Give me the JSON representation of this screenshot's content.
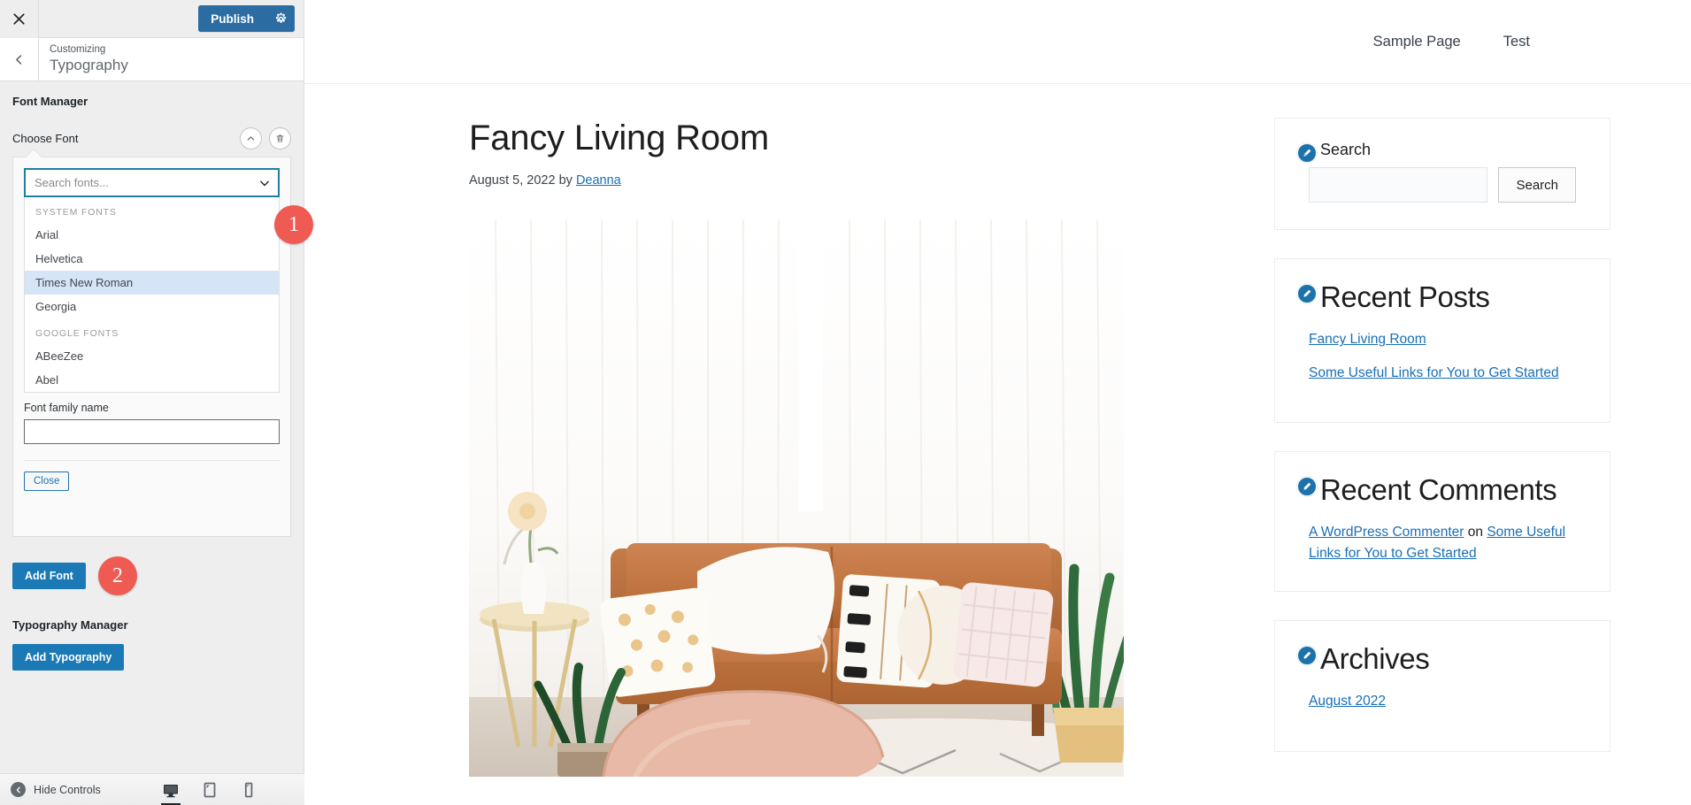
{
  "customizer": {
    "topbar": {
      "close_icon": "close-icon",
      "publish_label": "Publish",
      "publish_settings_icon": "gear-icon"
    },
    "panel": {
      "back_icon": "chevron-left-icon",
      "subtitle": "Customizing",
      "title": "Typography"
    },
    "font_manager": {
      "heading": "Font Manager",
      "choose_font_label": "Choose Font",
      "collapse_icon": "chevron-up-icon",
      "delete_icon": "trash-icon",
      "select": {
        "placeholder": "Search fonts...",
        "value": "",
        "caret_icon": "chevron-down-icon",
        "groups": [
          {
            "label": "SYSTEM FONTS",
            "options": [
              "Arial",
              "Helvetica",
              "Times New Roman",
              "Georgia"
            ]
          },
          {
            "label": "GOOGLE FONTS",
            "options": [
              "ABeeZee",
              "Abel"
            ]
          }
        ],
        "highlighted_option": "Times New Roman"
      },
      "font_family_name_label": "Font family name",
      "font_family_name_value": "",
      "close_label": "Close",
      "add_font_label": "Add Font"
    },
    "typography_manager": {
      "heading": "Typography Manager",
      "add_typography_label": "Add Typography"
    },
    "footer": {
      "hide_controls_label": "Hide Controls",
      "collapse_icon": "arrow-left-icon",
      "devices": [
        {
          "name": "desktop",
          "icon": "desktop-icon",
          "active": true
        },
        {
          "name": "tablet",
          "icon": "tablet-icon",
          "active": false
        },
        {
          "name": "mobile",
          "icon": "mobile-icon",
          "active": false
        }
      ]
    },
    "callouts": [
      {
        "number": "1",
        "target": "font-select"
      },
      {
        "number": "2",
        "target": "add-font-button"
      }
    ],
    "colors": {
      "accent_blue": "#2b6ca3",
      "button_blue": "#1b79b5",
      "focus_border": "#1d7ea3",
      "callout_red": "#ef5a52",
      "option_highlight": "#d6e4f7"
    }
  },
  "preview": {
    "nav": [
      {
        "label": "Sample Page"
      },
      {
        "label": "Test"
      }
    ],
    "post": {
      "title": "Fancy Living Room",
      "date": "August 5, 2022",
      "by_text": "by",
      "author": "Deanna",
      "image_alt": "Tan leather sofa with pillows in a bright living room"
    },
    "widgets": [
      {
        "id": "search",
        "edit_icon": "pencil-icon",
        "title": "Search",
        "size": "small",
        "input_value": "",
        "submit_label": "Search"
      },
      {
        "id": "recent-posts",
        "edit_icon": "pencil-icon",
        "title": "Recent Posts",
        "size": "large",
        "links": [
          "Fancy Living Room",
          "Some Useful Links for You to Get Started"
        ]
      },
      {
        "id": "recent-comments",
        "edit_icon": "pencil-icon",
        "title": "Recent Comments",
        "size": "large",
        "comment": {
          "author": "A WordPress Commenter",
          "connector": "on",
          "post": "Some Useful Links for You to Get Started"
        }
      },
      {
        "id": "archives",
        "edit_icon": "pencil-icon",
        "title": "Archives",
        "size": "large",
        "links": [
          "August 2022"
        ]
      }
    ]
  }
}
